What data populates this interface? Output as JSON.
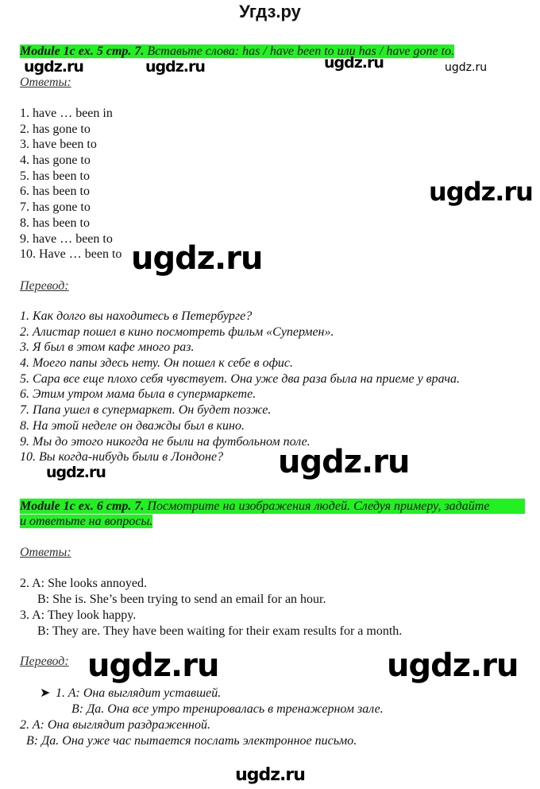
{
  "site_title": "Угдз.ру",
  "watermark": "ugdz.ru",
  "task1": {
    "ref": "Module 1c ex. 5 стр. 7.",
    "text": " Вставьте слова: has / have been to или has / have gone to."
  },
  "answers_label": "Ответы:",
  "translation_label": "Перевод:",
  "task1_answers": [
    "1. have … been in",
    "2. has gone to",
    "3. have been to",
    "4. has gone to",
    "5. has been to",
    "6. has been to",
    "7. has gone to",
    "8. has been to",
    "9. have … been to",
    "10. Have … been to"
  ],
  "task1_translation": [
    "1. Как долго вы находитесь в Петербурге?",
    "2. Алистар пошел в кино посмотреть фильм «Супермен».",
    "3. Я был в этом кафе много раз.",
    "4. Моего папы здесь нету. Он пошел к себе в офис.",
    "5. Сара все еще плохо себя чувствует. Она уже два раза была на приеме у врача.",
    "6. Этим утром мама была в супермаркете.",
    "7. Папа ушел в супермаркет. Он будет позже.",
    "8. На этой неделе он дважды был в кино.",
    "9. Мы до этого никогда не были на футбольном поле.",
    "10. Вы когда-нибудь были в Лондоне?"
  ],
  "task2": {
    "ref": "Module 1c ex. 6 стр. 7.",
    "text_line1": " Посмотрите на изображения людей. Следуя примеру, задайте",
    "text_line2": "и ответьте на вопросы."
  },
  "task2_answers": [
    "2. A: She looks annoyed.",
    "B: She is. She’s been trying to send an email for an hour.",
    "3. A: They look happy.",
    "B: They are. They have been waiting for their exam results for a month."
  ],
  "task2_translation": [
    "1. A: Она выглядит уставшей.",
    "B: Да. Она все утро тренировалась в тренажерном зале.",
    "2. A: Она выглядит раздраженной.",
    "B: Да. Она уже час пытается послать электронное письмо."
  ],
  "bullet_icon": "arrow-bullet-icon",
  "highlight_color": "#22f022"
}
